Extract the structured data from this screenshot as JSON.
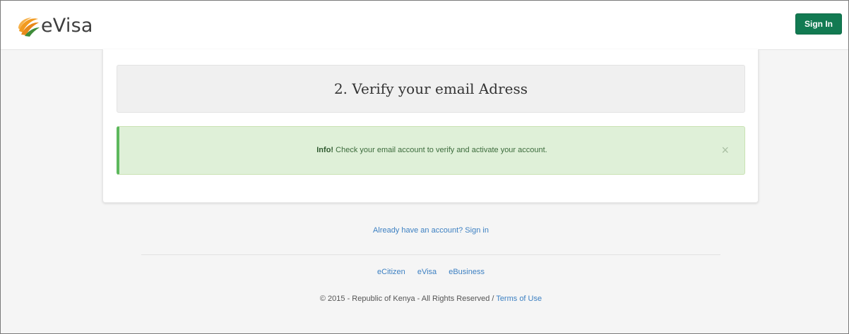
{
  "brand": {
    "name": "eVisa",
    "logo_icon": "evisa-swoosh-logo",
    "colors": {
      "orange": "#f29a1f",
      "green": "#3f8c3a"
    }
  },
  "header": {
    "signin_label": "Sign In",
    "signin_color": "#127a52"
  },
  "step": {
    "title": "2. Verify your email Adress"
  },
  "alert": {
    "prefix": "Info!",
    "message": " Check your email account to verify and activate your account.",
    "close_icon": "×",
    "background": "#dff0d8",
    "accent": "#5cb85c"
  },
  "account": {
    "signin_prompt": "Already have an account? Sign in"
  },
  "footer": {
    "links": [
      "eCitizen",
      "eVisa",
      "eBusiness"
    ],
    "copyright": "© 2015 - Republic of Kenya - All Rights Reserved / ",
    "terms_label": "Terms of Use",
    "link_color": "#3d80c2"
  }
}
